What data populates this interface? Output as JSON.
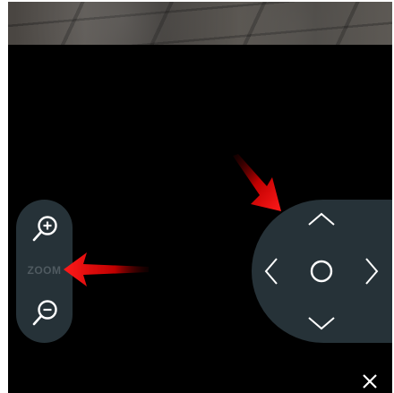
{
  "zoom": {
    "label": "ZOOM",
    "zoom_in_icon": "zoom-in-icon",
    "zoom_out_icon": "zoom-out-icon"
  },
  "dpad": {
    "up_icon": "chevron-up-icon",
    "down_icon": "chevron-down-icon",
    "left_icon": "chevron-left-icon",
    "right_icon": "chevron-right-icon",
    "center_icon": "circle-icon"
  },
  "close_icon": "close-icon",
  "colors": {
    "panel": "#263238",
    "icon": "#ffffff",
    "zoom_label": "#4f5a60",
    "annotation_arrow": "#e00000"
  }
}
